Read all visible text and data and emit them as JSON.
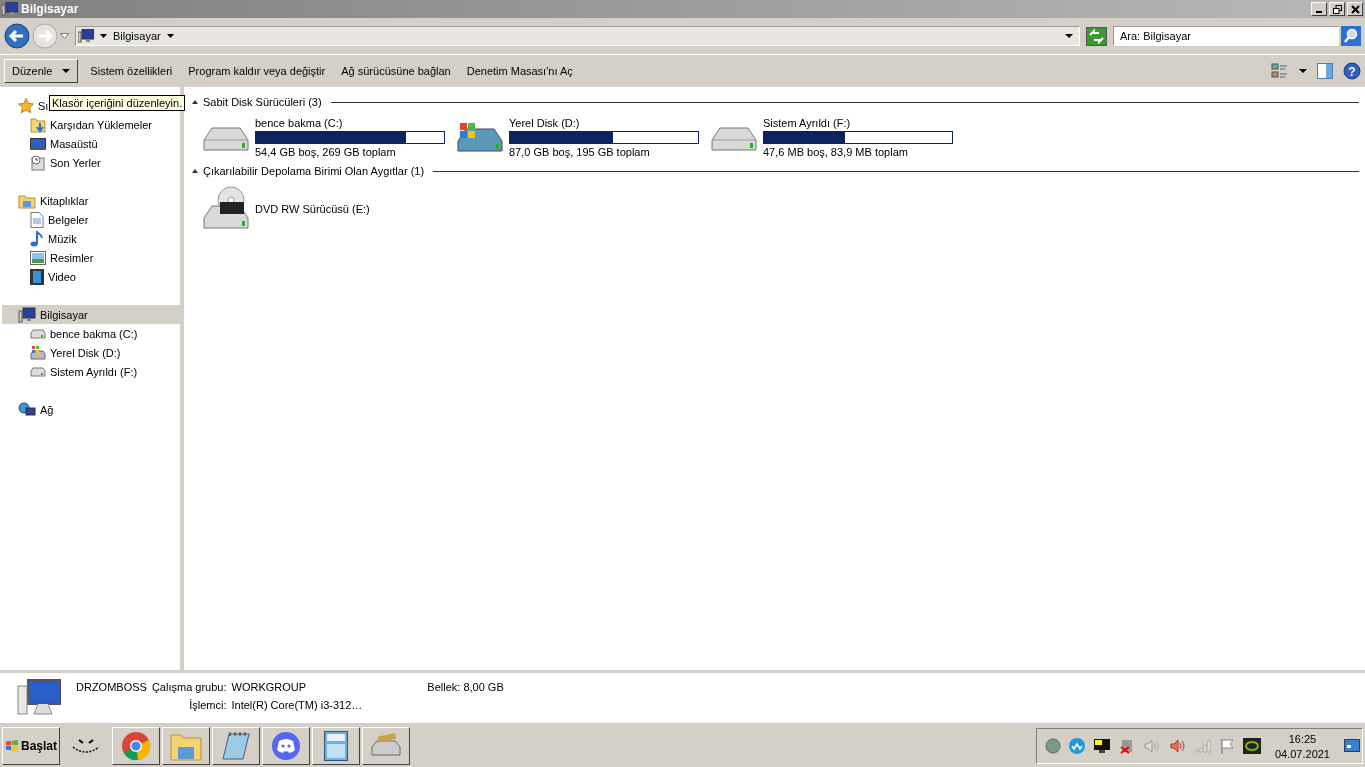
{
  "window": {
    "title": "Bilgisayar"
  },
  "address_bar": {
    "path": "Bilgisayar"
  },
  "search": {
    "placeholder": "Ara: Bilgisayar"
  },
  "toolbar": {
    "buttons": [
      {
        "label": "Düzenle",
        "kind": "menu"
      },
      {
        "label": "Sistem özellikleri",
        "kind": "link"
      },
      {
        "label": "Program kaldır veya değiştir",
        "kind": "link"
      },
      {
        "label": "Ağ sürücüsüne bağlan",
        "kind": "link"
      },
      {
        "label": "Denetim Masası'nı Aç",
        "kind": "link"
      }
    ]
  },
  "tooltip": "Klasör içeriğini düzenleyin.",
  "help": {
    "label": "?"
  },
  "sidebar": {
    "groups": [
      {
        "label": "Sı",
        "kind": "star",
        "selected": false,
        "children": [
          {
            "label": "Karşıdan Yüklemeler",
            "kind": "downloads",
            "selected": false
          },
          {
            "label": "Masaüstü",
            "kind": "desktop",
            "selected": false
          },
          {
            "label": "Son Yerler",
            "kind": "recent",
            "selected": false
          }
        ]
      },
      {
        "label": "Kitaplıklar",
        "kind": "library",
        "selected": false,
        "children": [
          {
            "label": "Belgeler",
            "kind": "document",
            "selected": false
          },
          {
            "label": "Müzik",
            "kind": "music",
            "selected": false
          },
          {
            "label": "Resimler",
            "kind": "picture",
            "selected": false
          },
          {
            "label": "Video",
            "kind": "video",
            "selected": false
          }
        ]
      },
      {
        "label": "Bilgisayar",
        "kind": "computer",
        "selected": true,
        "children": [
          {
            "label": "bence bakma (C:)",
            "kind": "drive",
            "selected": false
          },
          {
            "label": "Yerel Disk (D:)",
            "kind": "windrive",
            "selected": false
          },
          {
            "label": "Sistem Ayrıldı (F:)",
            "kind": "drive",
            "selected": false
          }
        ]
      },
      {
        "label": "Ağ",
        "kind": "network",
        "selected": false
      }
    ]
  },
  "sections": [
    {
      "title": "Sabit Disk Sürücüleri (3)",
      "expanded": true,
      "drives": [
        {
          "name": "bence bakma (C:)",
          "kind": "hdd",
          "level": 0.8,
          "space": "54,4 GB boş, 269 GB toplam"
        },
        {
          "name": "Yerel Disk (D:)",
          "kind": "windows-hdd",
          "level": 0.55,
          "space": "87,0 GB boş, 195 GB toplam"
        },
        {
          "name": "Sistem Ayrıldı (F:)",
          "kind": "hdd",
          "level": 0.43,
          "space": "47,6 MB boş, 83,9 MB toplam"
        }
      ]
    },
    {
      "title": "Çıkarılabilir Depolama Birimi Olan Aygıtlar (1)",
      "expanded": true,
      "drives": [
        {
          "name": "DVD RW Sürücüsü (E:)",
          "kind": "dvd"
        }
      ]
    }
  ],
  "details": {
    "name": "DRZOMBOSS",
    "workgroup_label": "Çalışma grubu:",
    "workgroup": "WORKGROUP",
    "memory_label": "Bellek:",
    "memory": "8,00 GB",
    "processor_label": "İşlemci:",
    "processor": "Intel(R) Core(TM) i3-312…"
  },
  "taskbar": {
    "start": "Başlat",
    "apps": [
      {
        "kind": "face"
      },
      {
        "kind": "browser"
      },
      {
        "kind": "folder"
      },
      {
        "kind": "notepad"
      },
      {
        "kind": "chat"
      },
      {
        "kind": "calculator"
      },
      {
        "kind": "drive"
      }
    ],
    "clock": {
      "time": "16:25",
      "date": "04.07.2021"
    }
  }
}
